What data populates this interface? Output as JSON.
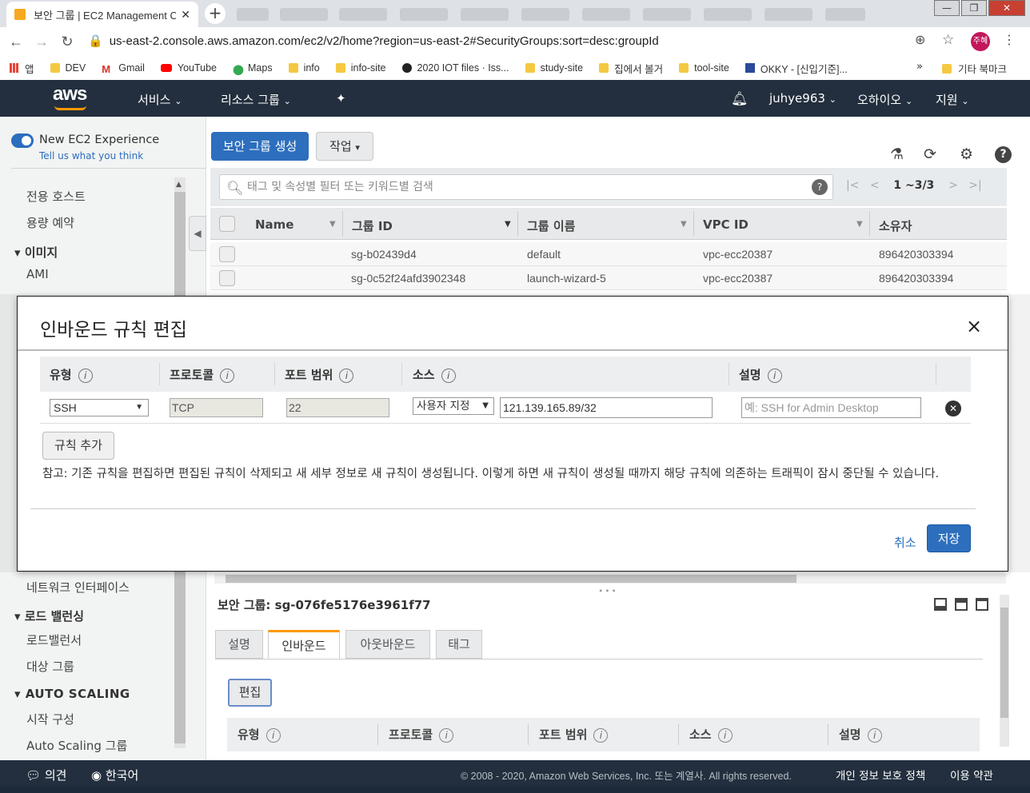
{
  "browser": {
    "tab_title": "보안 그룹 | EC2 Management C",
    "url": "us-east-2.console.aws.amazon.com/ec2/v2/home?region=us-east-2#SecurityGroups:sort=desc:groupId",
    "profile": "주혜",
    "bookmarks": [
      "앱",
      "DEV",
      "Gmail",
      "YouTube",
      "Maps",
      "info",
      "info-site",
      "2020 IOT files · Iss...",
      "study-site",
      "집에서 볼거",
      "tool-site",
      "OKKY - [신입기준]..."
    ],
    "bookmarks_more": "»",
    "other_bookmarks": "기타 북마크"
  },
  "aws_nav": {
    "logo": "aws",
    "services": "서비스",
    "resource_groups": "리소스 그룹",
    "user": "juhye963",
    "region": "오하이오",
    "support": "지원"
  },
  "sidebar": {
    "new_experience": "New EC2 Experience",
    "tell_us": "Tell us what you think",
    "items_top": [
      "전용 호스트",
      "용량 예약"
    ],
    "images_header": "이미지",
    "ami": "AMI",
    "network_interfaces": "네트워크 인터페이스",
    "lb_header": "로드 밸런싱",
    "lb_items": [
      "로드밸런서",
      "대상 그룹"
    ],
    "as_header": "AUTO SCALING",
    "as_items": [
      "시작 구성",
      "Auto Scaling 그룹"
    ]
  },
  "toolbar": {
    "create_sg": "보안 그룹 생성",
    "actions": "작업",
    "search_placeholder": "태그 및 속성별 필터 또는 키워드별 검색",
    "pager": "1 ~3/3"
  },
  "table": {
    "columns": [
      "Name",
      "그룹 ID",
      "그룹 이름",
      "VPC ID",
      "소유자"
    ],
    "rows": [
      {
        "name": "",
        "group_id": "sg-b02439d4",
        "group_name": "default",
        "vpc_id": "vpc-ecc20387",
        "owner": "896420303394"
      },
      {
        "name": "",
        "group_id": "sg-0c52f24afd3902348",
        "group_name": "launch-wizard-5",
        "vpc_id": "vpc-ecc20387",
        "owner": "896420303394"
      }
    ]
  },
  "modal": {
    "title": "인바운드 규칙 편집",
    "close": "×",
    "columns": [
      "유형",
      "프로토콜",
      "포트 범위",
      "소스",
      "설명"
    ],
    "rule": {
      "type": "SSH",
      "protocol": "TCP",
      "port_range": "22",
      "source_type": "사용자 지정",
      "source": "121.139.165.89/32",
      "description_placeholder": "예: SSH for Admin Desktop"
    },
    "add_rule": "규칙 추가",
    "note": "참고: 기존 규칙을 편집하면 편집된 규칙이 삭제되고 새 세부 정보로 새 규칙이 생성됩니다. 이렇게 하면 새 규칙이 생성될 때까지 해당 규칙에 의존하는 트래픽이 잠시 중단될 수 있습니다.",
    "cancel": "취소",
    "save": "저장"
  },
  "detail": {
    "title": "보안 그룹: sg-076fe5176e3961f77",
    "tabs": [
      "설명",
      "인바운드",
      "아웃바운드",
      "태그"
    ],
    "edit": "편집",
    "columns": [
      "유형",
      "프로토콜",
      "포트 범위",
      "소스",
      "설명"
    ]
  },
  "footer": {
    "feedback": "의견",
    "language": "한국어",
    "copyright": "© 2008 - 2020, Amazon Web Services, Inc. 또는 계열사. All rights reserved.",
    "privacy": "개인 정보 보호 정책",
    "terms": "이용 약관"
  },
  "colors": {
    "aws_dark": "#232f3e",
    "primary_blue": "#2d6fbd",
    "accent_orange": "#ff9900"
  }
}
